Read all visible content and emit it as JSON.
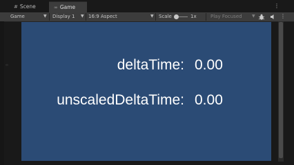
{
  "tabs": [
    {
      "label": "Scene",
      "icon": "scene-grid-icon"
    },
    {
      "label": "Game",
      "icon": "gamepad-icon"
    }
  ],
  "toolbar": {
    "view_mode": "Game",
    "display": "Display 1",
    "aspect": "16:9 Aspect",
    "scale_label": "Scale",
    "scale_value": "1x",
    "play_mode": "Play Focused"
  },
  "game": {
    "background_color": "#2b4b75",
    "delta_label": "deltaTime:",
    "delta_value": "0.00",
    "unscaled_label": "unscaledDeltaTime:",
    "unscaled_value": "0.00"
  }
}
